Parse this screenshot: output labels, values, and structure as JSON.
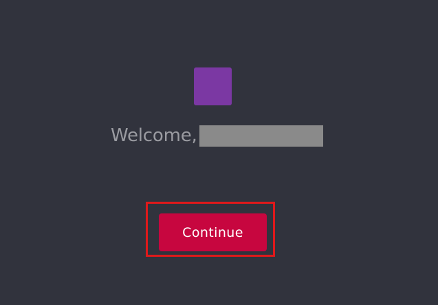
{
  "avatar": {
    "color": "#7b38a3"
  },
  "welcome": {
    "greeting": "Welcome,",
    "name_redacted": true
  },
  "actions": {
    "continue_label": "Continue",
    "continue_color": "#c7063f",
    "highlight_color": "#e0191b"
  }
}
